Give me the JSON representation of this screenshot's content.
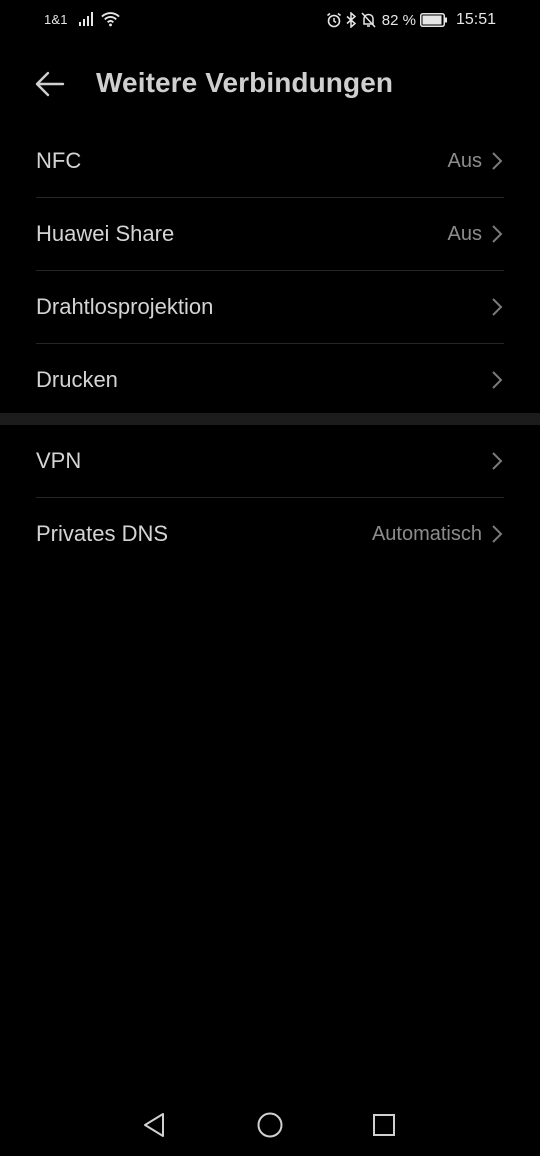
{
  "status_bar": {
    "carrier": "1&1",
    "battery_percent": "82 %",
    "time": "15:51",
    "icons": [
      "signal-icon",
      "wifi-icon",
      "alarm-icon",
      "bluetooth-icon",
      "mute-icon",
      "battery-icon"
    ]
  },
  "header": {
    "title": "Weitere Verbindungen",
    "back_icon": "arrow-left-icon"
  },
  "sections": [
    {
      "items": [
        {
          "label": "NFC",
          "value": "Aus"
        },
        {
          "label": "Huawei Share",
          "value": "Aus"
        },
        {
          "label": "Drahtlosprojektion",
          "value": ""
        },
        {
          "label": "Drucken",
          "value": ""
        }
      ]
    },
    {
      "items": [
        {
          "label": "VPN",
          "value": ""
        },
        {
          "label": "Privates DNS",
          "value": "Automatisch"
        }
      ]
    }
  ],
  "nav_bar": {
    "icons": [
      "triangle-back-icon",
      "circle-home-icon",
      "square-recents-icon"
    ]
  },
  "colors": {
    "background": "#000000",
    "text_primary": "#d4d4d4",
    "text_secondary": "#8c8c8c",
    "divider": "#262626",
    "section_gap": "#1c1c1c"
  }
}
